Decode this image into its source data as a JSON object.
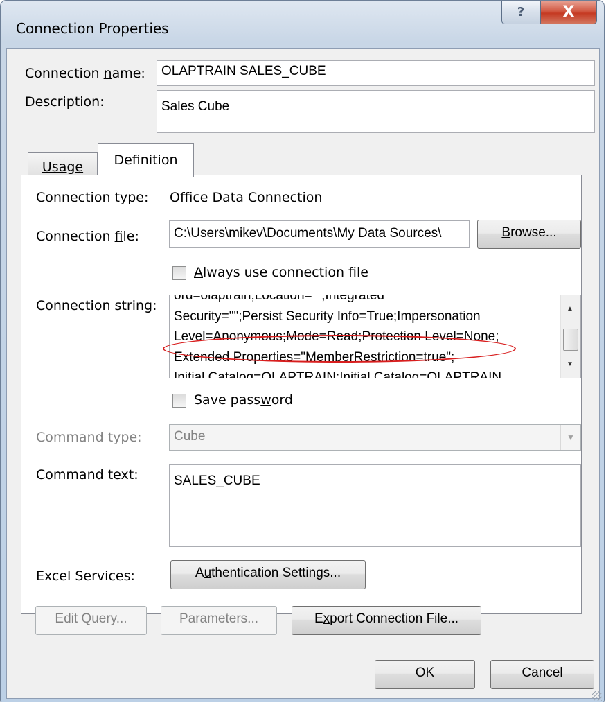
{
  "window": {
    "title": "Connection Properties",
    "help_glyph": "?",
    "close_glyph": "X"
  },
  "connection_name": {
    "label": "Connection name:",
    "value": "OLAPTRAIN SALES_CUBE"
  },
  "description": {
    "label": "Description:",
    "value": "Sales Cube"
  },
  "tabs": [
    {
      "label": "Usage",
      "active": false
    },
    {
      "label": "Definition",
      "active": true
    }
  ],
  "definition": {
    "connection_type": {
      "label": "Connection type:",
      "value": "Office Data Connection"
    },
    "connection_file": {
      "label": "Connection file:",
      "value": "C:\\Users\\mikev\\Documents\\My Data Sources\\",
      "browse": "Browse..."
    },
    "always_use_file": {
      "label": "Always use connection file",
      "checked": false
    },
    "connection_string": {
      "label": "Connection string:",
      "lines": [
        "ord=olaptrain;Location=\"\";Integrated",
        "Security=\"\";Persist Security Info=True;Impersonation",
        "Level=Anonymous;Mode=Read;Protection Level=None;",
        "Extended Properties=\"MemberRestriction=true\";",
        "Initial Catalog=OLAPTRAIN;Initial Catalog=OLAPTRAIN"
      ]
    },
    "save_password": {
      "label": "Save password",
      "checked": false
    },
    "command_type": {
      "label": "Command type:",
      "value": "Cube"
    },
    "command_text": {
      "label": "Command text:",
      "value": "SALES_CUBE"
    },
    "excel_services": {
      "label": "Excel Services:",
      "button": "Authentication Settings..."
    },
    "edit_query": "Edit Query...",
    "parameters": "Parameters...",
    "export": "Export Connection File..."
  },
  "footer": {
    "ok": "OK",
    "cancel": "Cancel"
  },
  "colors": {
    "highlight_ellipse": "#d81e1e",
    "close_button": "#c53a22"
  }
}
